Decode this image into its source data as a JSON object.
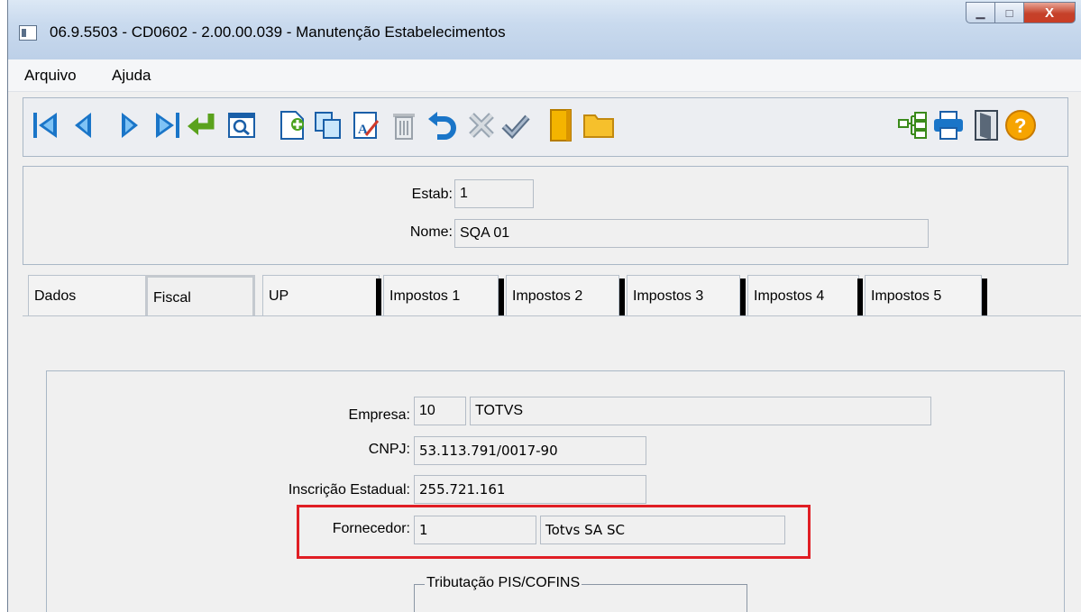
{
  "window": {
    "title": "06.9.5503 - CD0602 - 2.00.00.039 - Manutenção Estabelecimentos",
    "controls": {
      "minimize": "▁",
      "maximize": "□",
      "close": "X"
    }
  },
  "menu": {
    "items": [
      "Arquivo",
      "Ajuda"
    ]
  },
  "toolbar": {
    "icons": [
      "first-icon",
      "prev-icon",
      "next-icon",
      "last-icon",
      "goto-icon",
      "search-icon",
      "new-icon",
      "copy-icon",
      "edit-icon",
      "delete-icon",
      "undo-icon",
      "cancel-icon",
      "confirm-icon",
      "book-icon",
      "folder-icon",
      "tree-icon",
      "print-icon",
      "exit-icon",
      "help-icon"
    ]
  },
  "header": {
    "estab_label": "Estab:",
    "estab_value": "1",
    "nome_label": "Nome:",
    "nome_value": "SQA 01"
  },
  "tabs": [
    "Dados",
    "Fiscal",
    "UP",
    "Impostos 1",
    "Impostos 2",
    "Impostos 3",
    "Impostos 4",
    "Impostos 5"
  ],
  "fiscal": {
    "empresa_label": "Empresa:",
    "empresa_code": "10",
    "empresa_name": "TOTVS",
    "cnpj_label": "CNPJ:",
    "cnpj_value": "53.113.791/0017-90",
    "ie_label": "Inscrição Estadual:",
    "ie_value": "255.721.161",
    "fornecedor_label": "Fornecedor:",
    "fornecedor_code": "1",
    "fornecedor_name": "Totvs SA SC",
    "group_title": "Tributação PIS/COFINS"
  },
  "colors": {
    "highlight": "#e01e24",
    "close_button": "#c93d25"
  }
}
